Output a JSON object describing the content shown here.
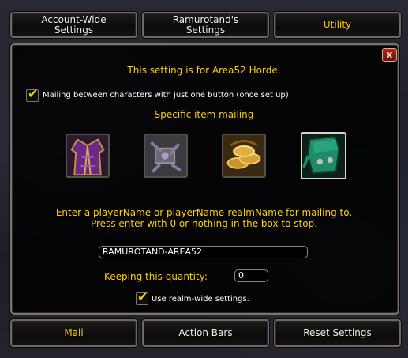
{
  "top_tabs": {
    "account_wide": [
      "Account-Wide",
      "Settings"
    ],
    "character": [
      "Ramurotand's",
      "Settings"
    ],
    "utility": "Utility"
  },
  "panel": {
    "close_label": "x",
    "setting_for": "This setting is for Area52 Horde.",
    "mailing_checkbox_label": "Mailing between characters with just one button (once set up)",
    "specific_item_heading": "Specific item mailing",
    "item_slots": [
      {
        "icon": "purple-robe-icon",
        "selected": false
      },
      {
        "icon": "engineering-device-icon",
        "selected": false
      },
      {
        "icon": "gold-coins-icon",
        "selected": false
      },
      {
        "icon": "green-leather-bag-icon",
        "selected": true
      }
    ],
    "instruction_line1": "Enter a playerName or playerName-realmName for mailing to.",
    "instruction_line2": "Press enter with 0 or nothing in the box to stop.",
    "recipient_value": "RAMUROTAND-AREA52",
    "quantity_label": "Keeping this quantity:",
    "quantity_value": "0",
    "realm_wide_label": "Use realm-wide settings."
  },
  "bottom_tabs": {
    "mail": "Mail",
    "action_bars": "Action Bars",
    "reset": "Reset Settings"
  },
  "colors": {
    "gold": "#ffd100",
    "white": "#ffffff",
    "border": "#7a766c"
  }
}
